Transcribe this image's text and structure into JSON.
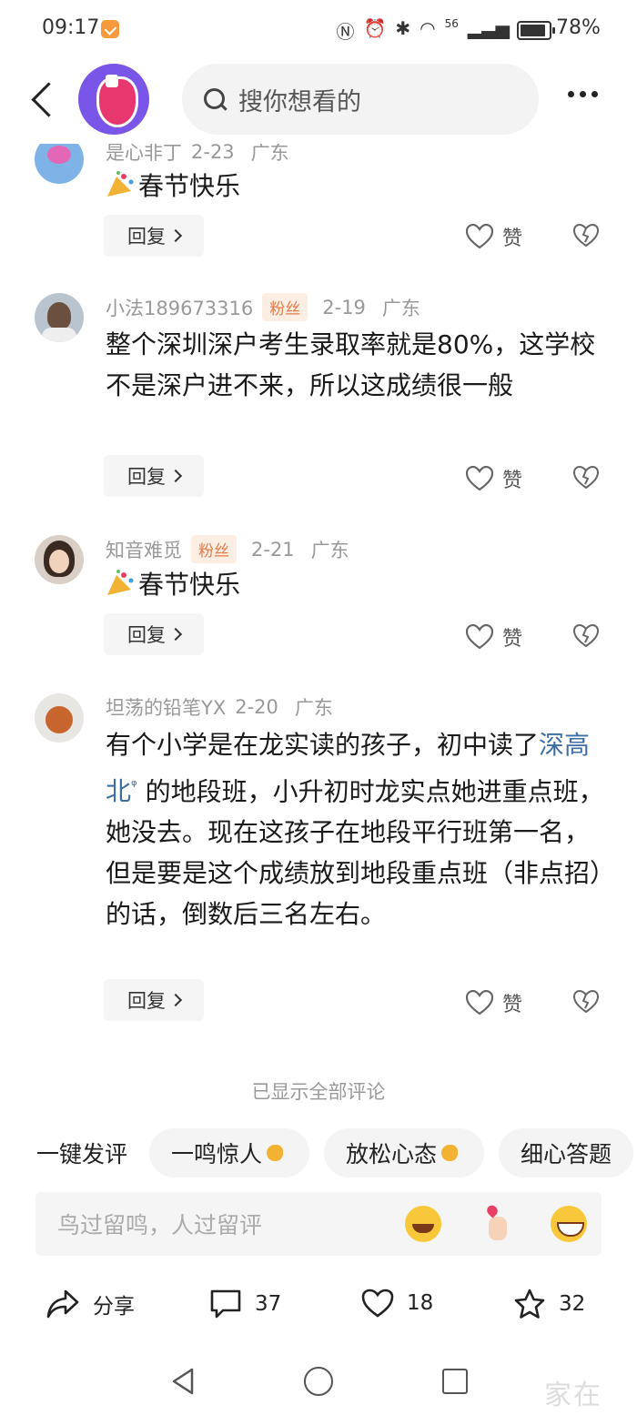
{
  "status_bar": {
    "time": "09:17",
    "icons": [
      "nfc-icon",
      "alarm-icon",
      "bluetooth-icon",
      "wifi-icon",
      "5g-signal-icon"
    ],
    "signal_label": "56",
    "battery_percent": 78,
    "battery_label": "78%"
  },
  "header": {
    "search_placeholder": "搜你想看的"
  },
  "comments": [
    {
      "name": "是心非丁",
      "fan_badge": "",
      "date": "2-23",
      "location": "广东",
      "text": "春节快乐",
      "has_emoji": true,
      "reply_label": "回复",
      "like_label": "赞"
    },
    {
      "name": "小法189673316",
      "fan_badge": "粉丝",
      "date": "2-19",
      "location": "广东",
      "text": "整个深圳深户考生录取率就是80%，这学校不是深户进不来，所以这成绩很一般",
      "has_emoji": false,
      "reply_label": "回复",
      "like_label": "赞"
    },
    {
      "name": "知音难觅",
      "fan_badge": "粉丝",
      "date": "2-21",
      "location": "广东",
      "text": "春节快乐",
      "has_emoji": true,
      "reply_label": "回复",
      "like_label": "赞"
    },
    {
      "name": "坦荡的铅笔YX",
      "fan_badge": "",
      "date": "2-20",
      "location": "广东",
      "text_before": "有个小学是在龙实读的孩子，初中读了",
      "link_text": "深高北",
      "text_after": " 的地段班，小升初时龙实点她进重点班，她没去。现在这孩子在地段平行班第一名，但是要是这个成绩放到地段重点班（非点招）的话，倒数后三名左右。",
      "reply_label": "回复",
      "like_label": "赞"
    }
  ],
  "all_shown_text": "已显示全部评论",
  "quick_comment": {
    "label": "一键发评",
    "chips": [
      "一鸣惊人",
      "放松心态",
      "细心答题"
    ]
  },
  "input": {
    "placeholder": "鸟过留鸣，人过留评",
    "emojis": [
      "laughing-tears-emoji",
      "finger-heart-emoji",
      "grinning-emoji"
    ]
  },
  "actions": {
    "share_label": "分享",
    "comment_count": "37",
    "like_count": "18",
    "favorite_count": "32"
  },
  "watermark": "家在"
}
